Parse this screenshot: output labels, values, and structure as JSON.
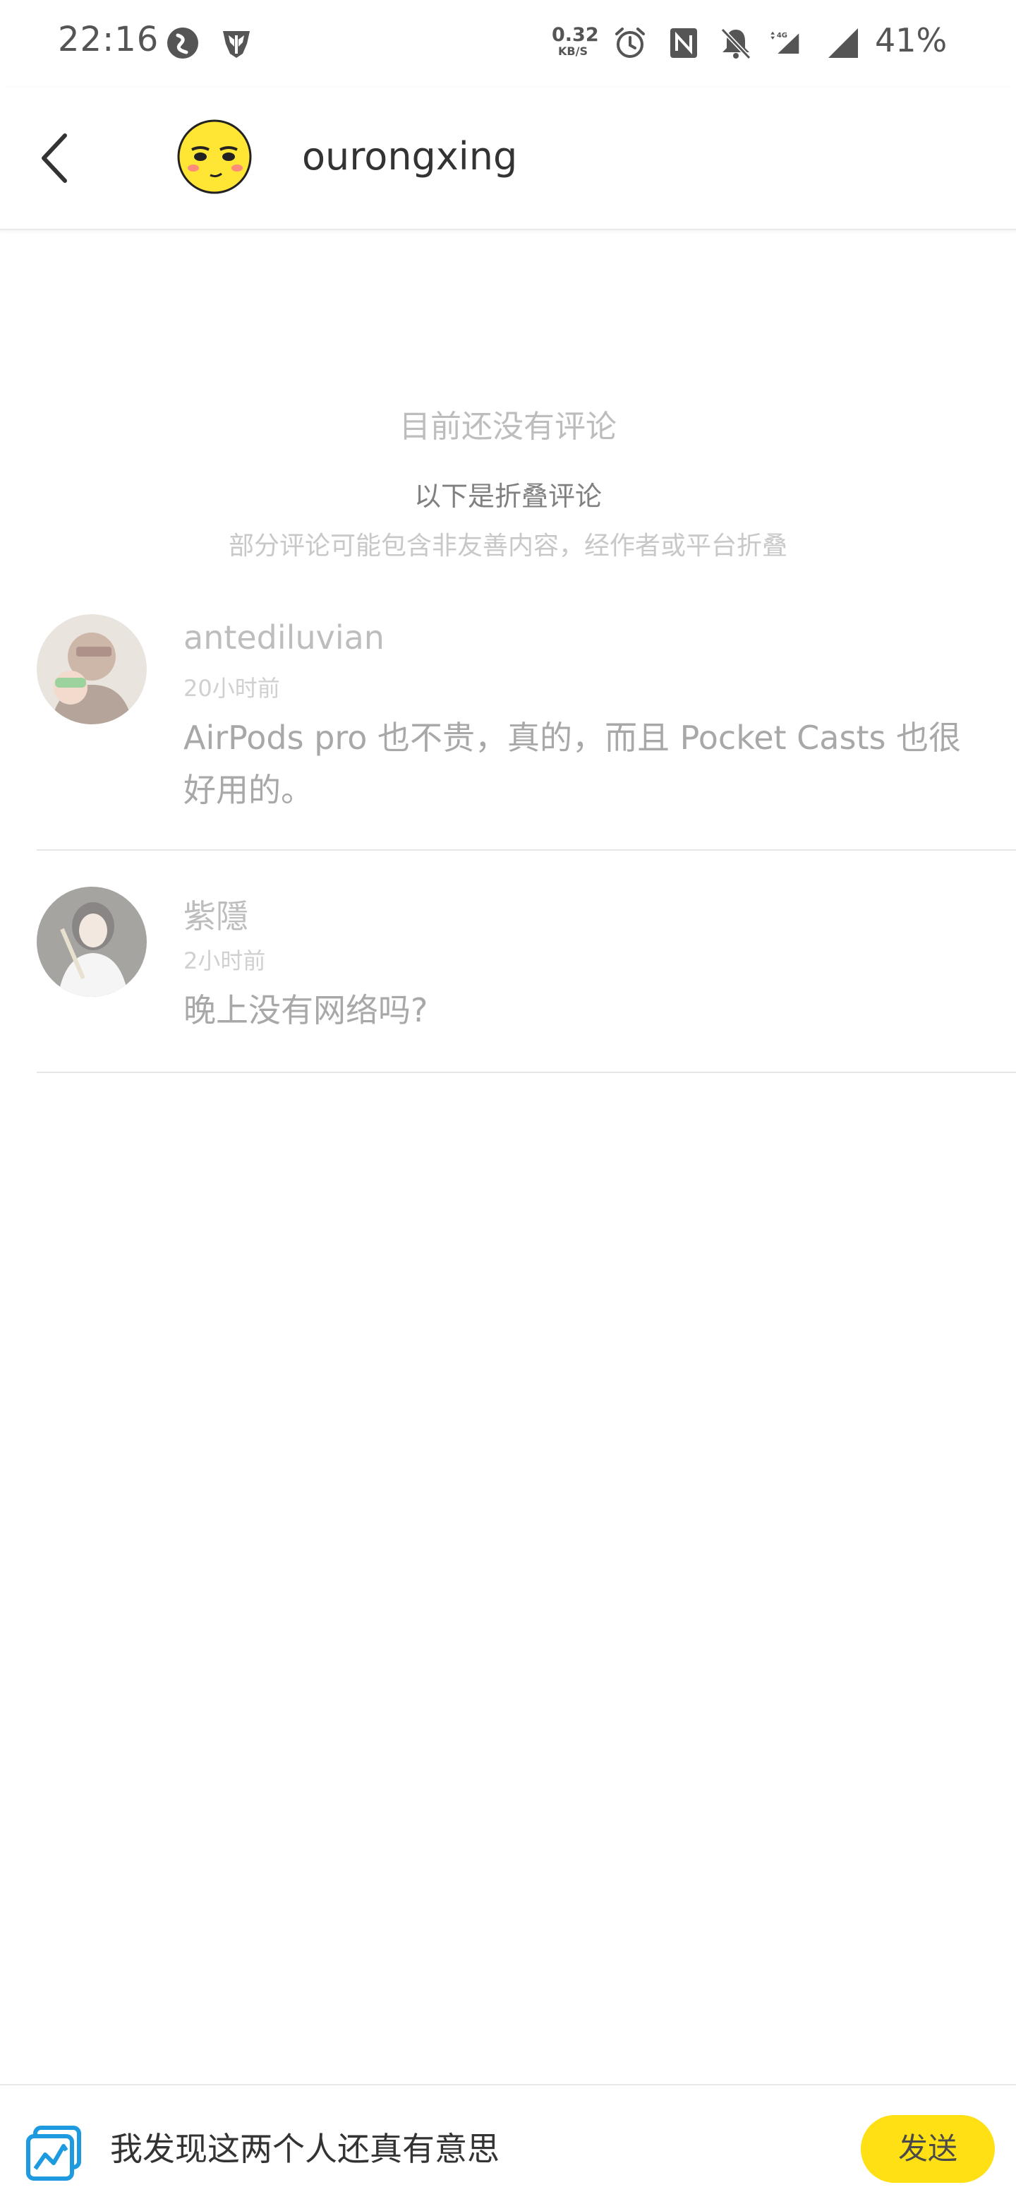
{
  "status_bar": {
    "time": "22:16",
    "net_speed_value": "0.32",
    "net_speed_unit": "KB/S",
    "network_type": "4G",
    "battery": "41%",
    "icons": [
      "soul-app-icon",
      "transformers-icon",
      "alarm-icon",
      "nfc-icon",
      "mute-icon",
      "signal-icon",
      "signal-icon"
    ]
  },
  "header": {
    "title": "ourongxing"
  },
  "notices": {
    "no_comments": "目前还没有评论",
    "folded_title": "以下是折叠评论",
    "folded_desc": "部分评论可能包含非友善内容，经作者或平台折叠"
  },
  "comments": [
    {
      "author": "antediluvian",
      "time": "20小时前",
      "content": "AirPods pro 也不贵，真的，而且 Pocket Casts 也很好用的。"
    },
    {
      "author": "紫隱",
      "time": "2小时前",
      "content": "晚上没有网络吗?"
    }
  ],
  "input_bar": {
    "value": "我发现这两个人还真有意思",
    "send_label": "发送"
  },
  "colors": {
    "accent": "#ffe014",
    "image_icon": "#1e9be0"
  }
}
